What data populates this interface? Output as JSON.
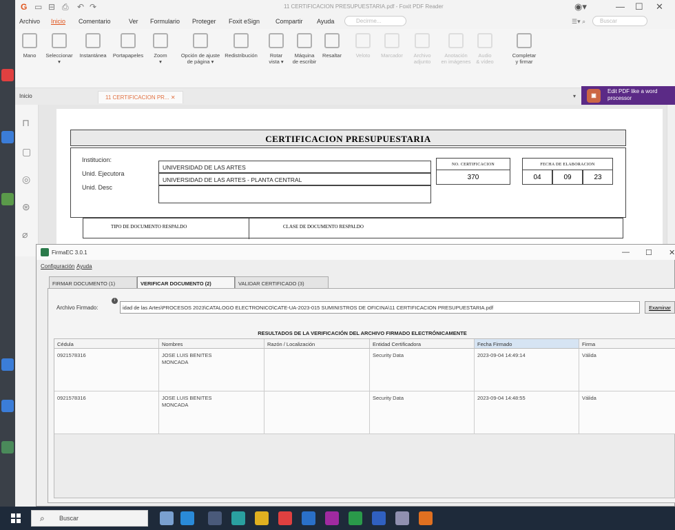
{
  "foxit": {
    "window_title": "11 CERTIFICACION PRESUPUESTARIA.pdf - Foxit PDF Reader",
    "menu": [
      "Archivo",
      "Inicio",
      "Comentario",
      "Ver",
      "Formulario",
      "Proteger",
      "Foxit eSign",
      "Compartir",
      "Ayuda"
    ],
    "search_placeholder": "Decirme...",
    "find_placeholder": "Buscar",
    "ribbon": [
      {
        "label": "Mano",
        "dim": false
      },
      {
        "label": "Seleccionar\n▾",
        "dim": false
      },
      {
        "label": "Instantánea",
        "dim": false
      },
      {
        "label": "Portapapeles",
        "dim": false
      },
      {
        "label": "Zoom\n▾",
        "dim": false
      },
      {
        "label": "Opción de ajuste\nde página ▾",
        "dim": false
      },
      {
        "label": "Redistribución",
        "dim": false
      },
      {
        "label": "Rotar\nvista ▾",
        "dim": false
      },
      {
        "label": "Máquina\nde escribir",
        "dim": false
      },
      {
        "label": "Resaltar",
        "dim": false
      },
      {
        "label": "Veloto",
        "dim": true
      },
      {
        "label": "Marcador",
        "dim": true
      },
      {
        "label": "Archivo\nadjunto",
        "dim": true
      },
      {
        "label": "Anotación\nen imágenes",
        "dim": true
      },
      {
        "label": "Audio\n& vídeo",
        "dim": true
      },
      {
        "label": "Completar\ny firmar",
        "dim": false
      }
    ],
    "tabs": {
      "home": "Inicio",
      "doc": "11 CERTIFICACION PR...  ✕"
    },
    "promo": "Edit PDF like a word processor"
  },
  "certificate": {
    "title": "CERTIFICACION PRESUPUESTARIA",
    "institucion_label": "Institucion:",
    "institucion": "UNIVERSIDAD DE LAS ARTES",
    "ejecutora_label": "Unid. Ejecutora",
    "ejecutora": "UNIVERSIDAD DE LAS ARTES - PLANTA CENTRAL",
    "desc_label": "Unid. Desc",
    "desc": "",
    "no_cert_label": "NO. CERTIFICACION",
    "no_cert": "370",
    "fecha_label": "FECHA DE ELABORACION",
    "fecha": [
      "04",
      "09",
      "23"
    ],
    "tipo_doc_label": "TIPO DE DOCUMENTO RESPALDO",
    "clase_doc_label": "CLASE DE DOCUMENTO RESPALDO"
  },
  "firmaec": {
    "title": "FirmaEC 3.0.1",
    "menu": [
      "Configuración",
      "Ayuda"
    ],
    "tabs": [
      "FIRMAR DOCUMENTO (1)",
      "VERIFICAR DOCUMENTO (2)",
      "VALIDAR CERTIFICADO (3)"
    ],
    "archivo_label": "Archivo Firmado:",
    "archivo_value": "idad de las Artes\\PROCESOS 2023\\CATALOGO ELECTRONICO\\CATE-UA-2023-015 SUMINISTROS DE OFICINA\\11 CERTIFICACION PRESUPUESTARIA.pdf",
    "examinar": "Examinar",
    "results_title": "RESULTADOS DE LA VERIFICACIÓN DEL ARCHIVO FIRMADO ELECTRÓNICAMENTE",
    "columns": [
      "Cédula",
      "Nombres",
      "Razón / Localización",
      "Entidad Certificadora",
      "Fecha Firmado",
      "Firma"
    ],
    "rows": [
      [
        "0921578316",
        "JOSE LUIS BENITES\nMONCADA",
        "",
        "Security Data",
        "2023-09-04 14:49:14",
        "Válida"
      ],
      [
        "0921578316",
        "JOSE LUIS BENITES\nMONCADA",
        "",
        "Security Data",
        "2023-09-04 14:48:55",
        "Válida"
      ]
    ]
  },
  "taskbar": {
    "search": "Buscar"
  },
  "colors": {
    "accent": "#e0541c",
    "taskbar": "#1e2a3a",
    "promo": "#5b2a86"
  }
}
